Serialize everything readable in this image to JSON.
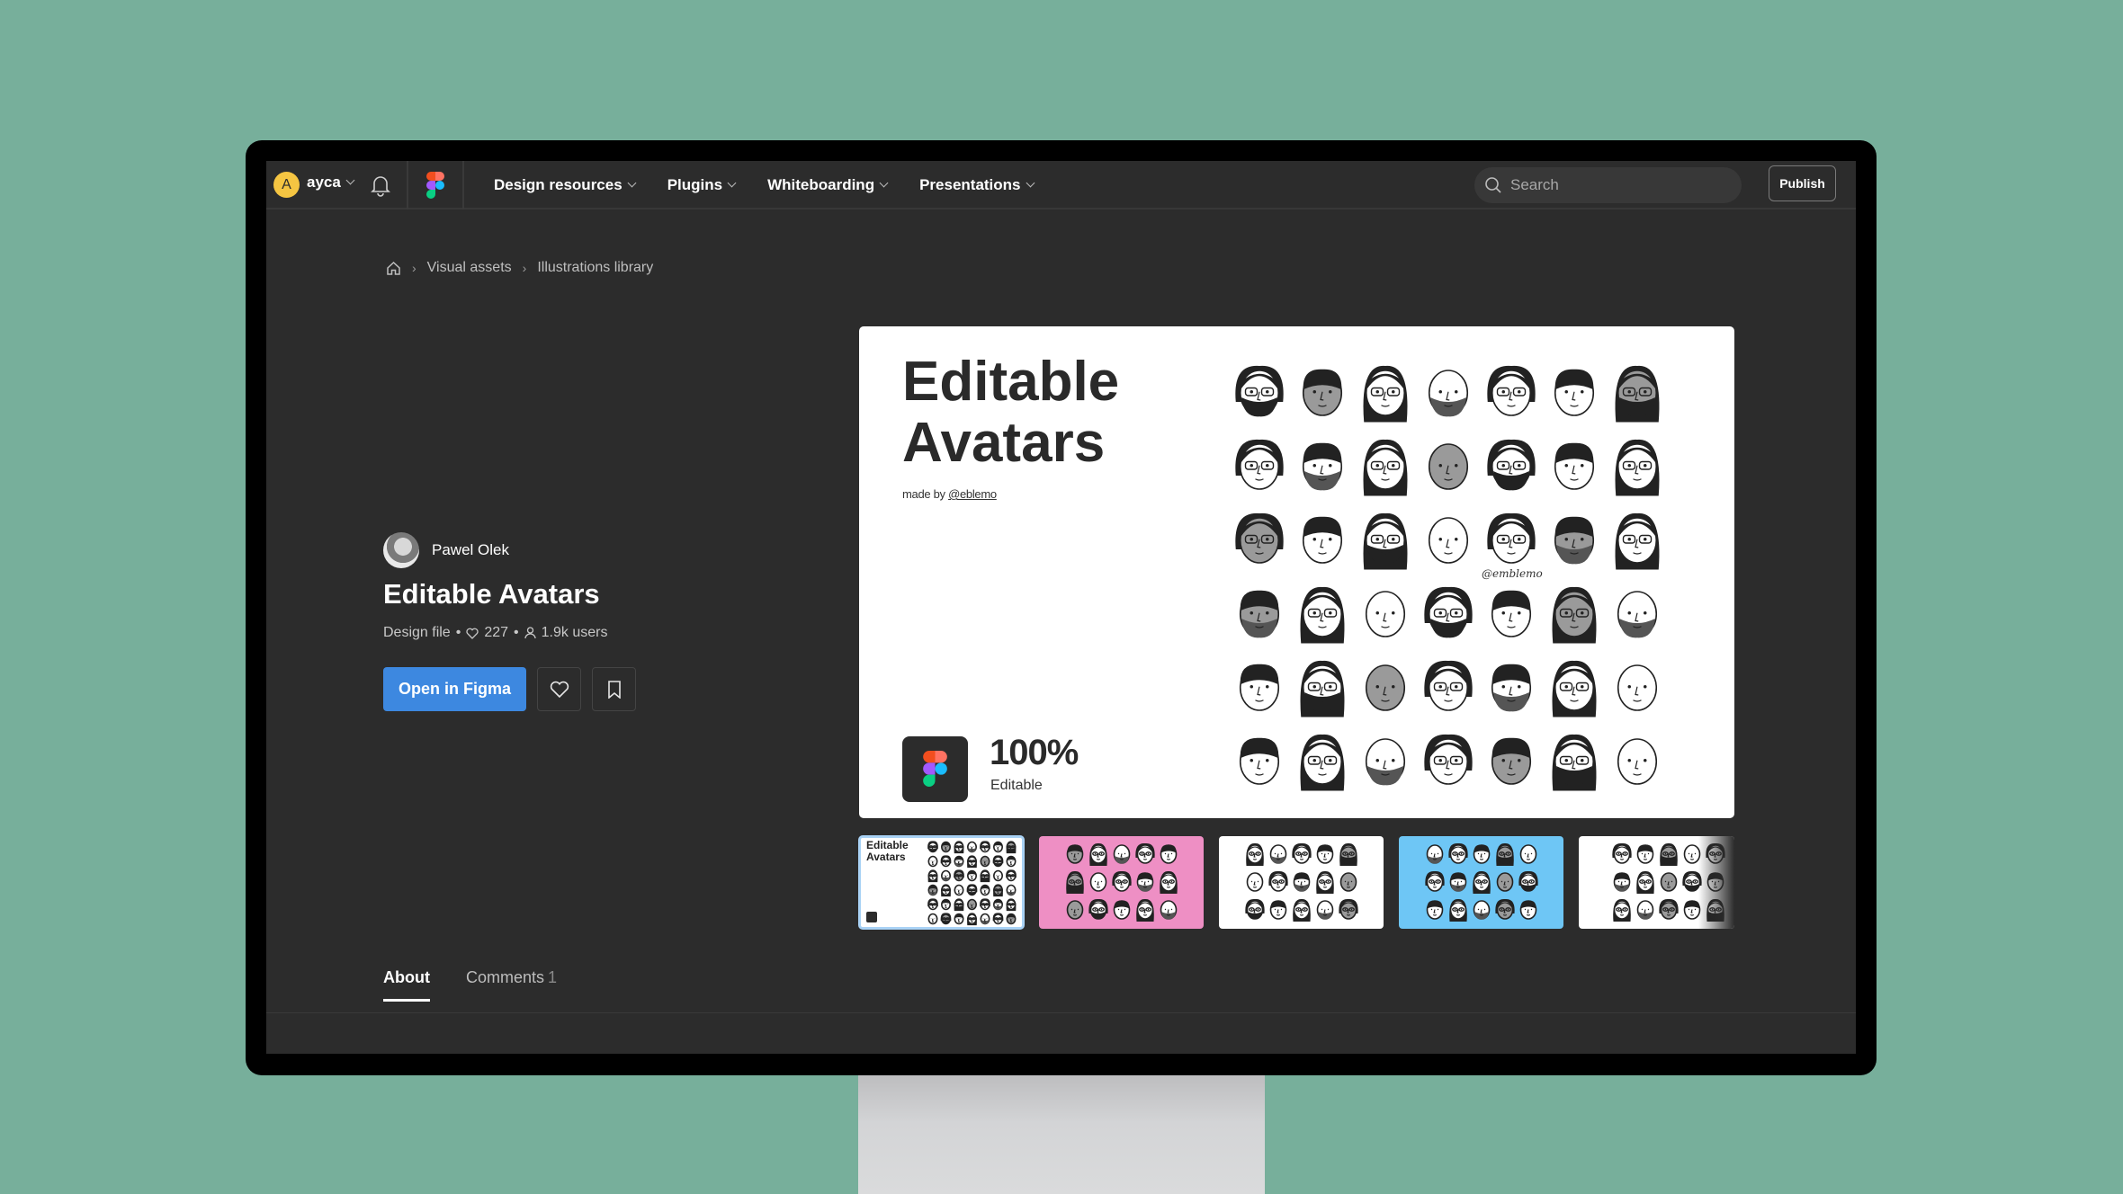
{
  "nav": {
    "user_initial": "A",
    "username": "ayca",
    "menu": [
      {
        "label": "Design resources"
      },
      {
        "label": "Plugins"
      },
      {
        "label": "Whiteboarding"
      },
      {
        "label": "Presentations"
      }
    ],
    "search_placeholder": "Search",
    "publish_label": "Publish"
  },
  "breadcrumb": {
    "home_icon": "home-icon",
    "items": [
      "Visual assets",
      "Illustrations library"
    ]
  },
  "resource": {
    "author": "Pawel Olek",
    "title": "Editable Avatars",
    "type": "Design file",
    "likes": "227",
    "users": "1.9k users",
    "open_label": "Open in Figma"
  },
  "preview": {
    "title_line1": "Editable",
    "title_line2": "Avatars",
    "made_by_prefix": "made by",
    "made_by_handle": "@eblemo",
    "percent": "100%",
    "percent_label": "Editable",
    "handle_note": "@emblemo"
  },
  "thumbnails": [
    {
      "label": "cover",
      "bg": "#ffffff",
      "active": true
    },
    {
      "label": "pink-set",
      "bg": "#ee8fc4",
      "active": false
    },
    {
      "label": "white-set",
      "bg": "#ffffff",
      "active": false
    },
    {
      "label": "blue-set",
      "bg": "#6ec6f5",
      "active": false
    },
    {
      "label": "white-set-2",
      "bg": "#ffffff",
      "active": false
    }
  ],
  "tabs": [
    {
      "label": "About",
      "count": ""
    },
    {
      "label": "Comments",
      "count": "1"
    }
  ],
  "colors": {
    "accent": "#3d88e0",
    "user_avatar": "#f5c542",
    "page_bg": "#77af9b",
    "screen_bg": "#2c2c2c"
  }
}
